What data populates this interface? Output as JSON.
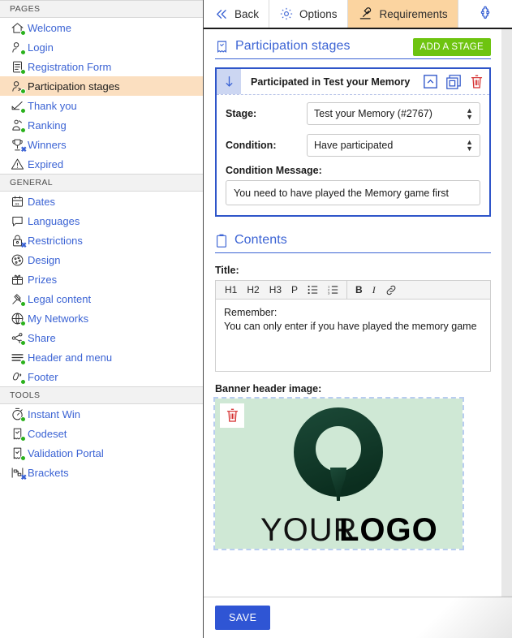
{
  "sidebar": {
    "groups": [
      {
        "title": "PAGES",
        "items": [
          {
            "label": "Welcome",
            "icon": "home-icon",
            "badge": "dot",
            "active": false
          },
          {
            "label": "Login",
            "icon": "user-login-icon",
            "badge": "dot",
            "active": false
          },
          {
            "label": "Registration Form",
            "icon": "form-icon",
            "badge": "dot",
            "active": false
          },
          {
            "label": "Participation stages",
            "icon": "user-stages-icon",
            "badge": "dot",
            "active": true
          },
          {
            "label": "Thank you",
            "icon": "check-icon",
            "badge": "dot",
            "active": false
          },
          {
            "label": "Ranking",
            "icon": "podium-icon",
            "badge": "dot",
            "active": false
          },
          {
            "label": "Winners",
            "icon": "trophy-icon",
            "badge": "x",
            "active": false
          },
          {
            "label": "Expired",
            "icon": "warning-icon",
            "badge": "none",
            "active": false
          }
        ]
      },
      {
        "title": "GENERAL",
        "items": [
          {
            "label": "Dates",
            "icon": "calendar-icon",
            "badge": "none",
            "active": false
          },
          {
            "label": "Languages",
            "icon": "speech-bubble-icon",
            "badge": "none",
            "active": false
          },
          {
            "label": "Restrictions",
            "icon": "lock-icon",
            "badge": "x",
            "active": false
          },
          {
            "label": "Design",
            "icon": "palette-icon",
            "badge": "none",
            "active": false
          },
          {
            "label": "Prizes",
            "icon": "gift-icon",
            "badge": "none",
            "active": false
          },
          {
            "label": "Legal content",
            "icon": "gavel-icon",
            "badge": "dot",
            "active": false
          },
          {
            "label": "My Networks",
            "icon": "globe-icon",
            "badge": "dot",
            "active": false
          },
          {
            "label": "Share",
            "icon": "share-icon",
            "badge": "dot",
            "active": false
          },
          {
            "label": "Header and menu",
            "icon": "menu-lines-icon",
            "badge": "dot",
            "active": false
          },
          {
            "label": "Footer",
            "icon": "footprint-icon",
            "badge": "dot",
            "active": false
          }
        ]
      },
      {
        "title": "TOOLS",
        "items": [
          {
            "label": "Instant Win",
            "icon": "stopwatch-icon",
            "badge": "dot",
            "active": false
          },
          {
            "label": "Codeset",
            "icon": "ticket-icon",
            "badge": "dot",
            "active": false
          },
          {
            "label": "Validation Portal",
            "icon": "validation-ticket-icon",
            "badge": "dot",
            "active": false
          },
          {
            "label": "Brackets",
            "icon": "brackets-icon",
            "badge": "x",
            "active": false
          }
        ]
      }
    ]
  },
  "tabs": [
    {
      "label": "Back",
      "icon": "double-chevron-left-icon",
      "active": false
    },
    {
      "label": "Options",
      "icon": "gear-icon",
      "active": false
    },
    {
      "label": "Requirements",
      "icon": "stamp-icon",
      "active": true
    },
    {
      "label": "",
      "icon": "puzzle-icon",
      "active": false
    }
  ],
  "participation": {
    "section_title": "Participation stages",
    "section_icon": "ticket-icon",
    "add_stage_label": "ADD A STAGE",
    "stage": {
      "title": "Participated in Test your Memory",
      "drag_icon": "down-arrow-icon",
      "actions": [
        {
          "name": "collapse-icon",
          "label": "collapse"
        },
        {
          "name": "duplicate-icon",
          "label": "duplicate"
        },
        {
          "name": "delete-icon",
          "label": "delete"
        }
      ],
      "stage_label": "Stage:",
      "stage_value": "Test your Memory (#2767)",
      "condition_label": "Condition:",
      "condition_value": "Have participated",
      "condition_message_label": "Condition Message:",
      "condition_message_value": "You need to have played the Memory game first"
    }
  },
  "contents": {
    "section_title": "Contents",
    "section_icon": "clipboard-icon",
    "title_label": "Title:",
    "editor_buttons": [
      "H1",
      "H2",
      "H3",
      "P"
    ],
    "editor_icons": [
      "bullet-list-icon",
      "numbered-list-icon",
      "bold-icon",
      "italic-icon",
      "link-icon"
    ],
    "editor_bold": "B",
    "editor_italic": "I",
    "editor_text": "Remember:\nYou can only enter if you have played the memory game",
    "banner_label": "Banner header image:",
    "banner_delete_icon": "delete-icon",
    "banner_logo_text_light": "YOUR",
    "banner_logo_text_bold": "LOGO"
  },
  "footer": {
    "save_label": "SAVE"
  },
  "colors": {
    "accent_blue": "#3b63d4",
    "active_nav_bg": "#fbdfc0",
    "active_tab_bg": "#fbd4a0",
    "green_button": "#6ec410",
    "save_blue": "#2f55d4",
    "delete_red": "#d42a2a",
    "status_dot_green": "#2ab11c",
    "banner_bg": "#cfe8d5",
    "logo_green": "#0f3d2b"
  }
}
